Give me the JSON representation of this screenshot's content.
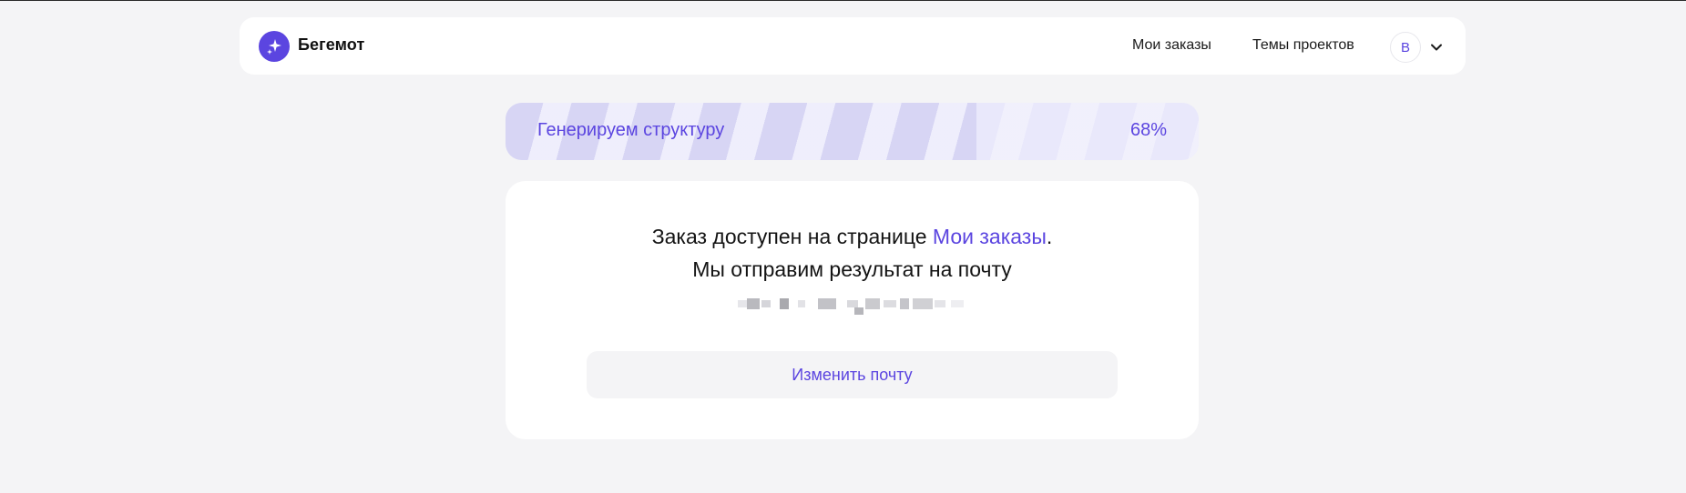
{
  "app": {
    "brand_name": "Бегемот",
    "logo_icon": "sparkle-icon",
    "accent_color": "#5b45e0"
  },
  "header": {
    "nav": [
      {
        "label": "Мои заказы"
      },
      {
        "label": "Темы проектов"
      }
    ],
    "avatar_initial": "В",
    "menu_icon": "chevron-down-icon"
  },
  "progress": {
    "label": "Генерируем структуру",
    "value_text": "68%",
    "value": 0.68
  },
  "message": {
    "line1_prefix": "Заказ доступен на странице ",
    "line1_link": "Мои заказы",
    "line1_suffix": ".",
    "line2": "Мы отправим результат на почту"
  },
  "actions": {
    "change_email_label": "Изменить почту"
  }
}
